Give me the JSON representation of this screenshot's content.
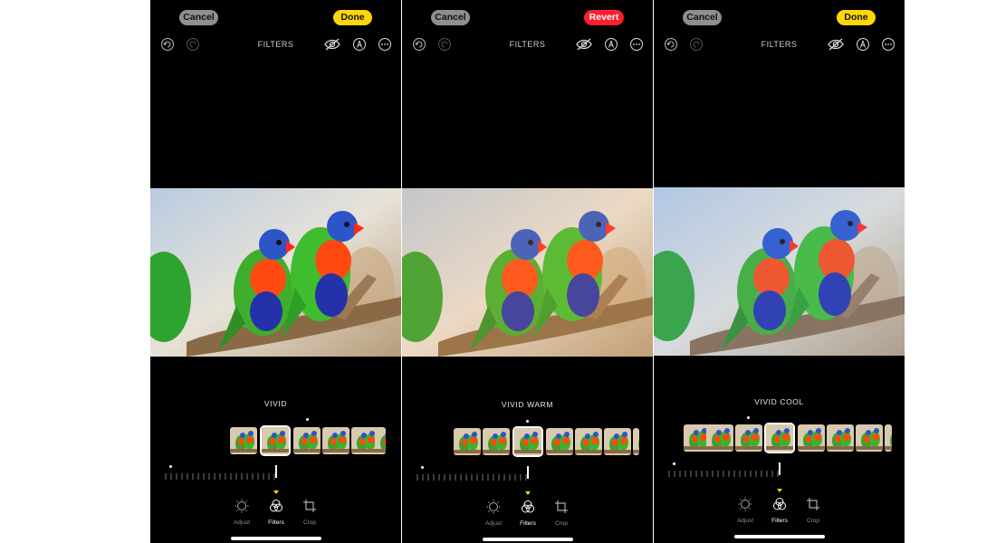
{
  "panels": [
    {
      "cancel_label": "Cancel",
      "right_label": "Done",
      "right_type": "done",
      "title": "FILTERS",
      "filter_name": "VIVID",
      "tools": {
        "adjust": "Adjust",
        "filters": "Filters",
        "crop": "Crop"
      }
    },
    {
      "cancel_label": "Cancel",
      "right_label": "Revert",
      "right_type": "revert",
      "title": "FILTERS",
      "filter_name": "VIVID WARM",
      "tools": {
        "adjust": "Adjust",
        "filters": "Filters",
        "crop": "Crop"
      }
    },
    {
      "cancel_label": "Cancel",
      "right_label": "Done",
      "right_type": "done",
      "title": "FILTERS",
      "filter_name": "VIVID COOL",
      "tools": {
        "adjust": "Adjust",
        "filters": "Filters",
        "crop": "Crop"
      }
    }
  ],
  "colors": {
    "done": "#ffd60a",
    "revert": "#ff1e2d",
    "cancel": "#8e8e93",
    "active_caret": "#ffd60a"
  },
  "icons": [
    "undo-icon",
    "redo-icon",
    "hide-eye-icon",
    "auto-enhance-icon",
    "more-icon",
    "adjust-icon",
    "filters-icon",
    "crop-icon"
  ]
}
